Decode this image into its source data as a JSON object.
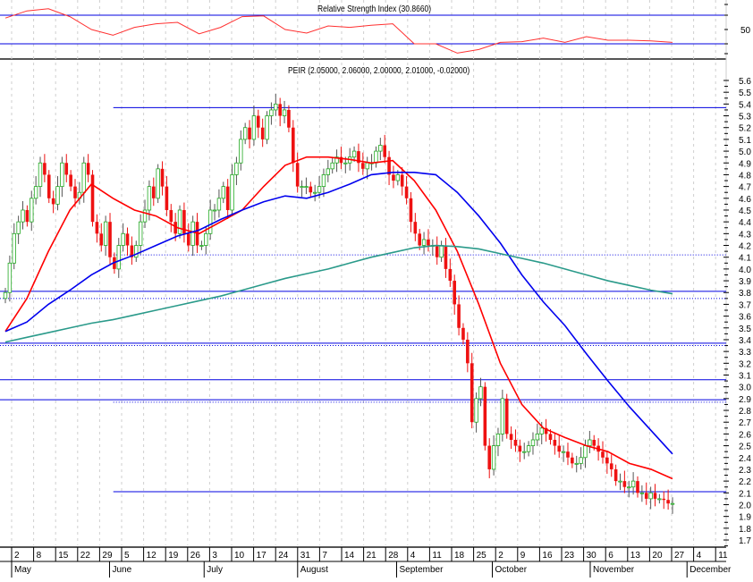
{
  "rsi_panel": {
    "title": "Relative Strength Index (30.8660)",
    "level_label": "50",
    "upper_level": 70,
    "lower_level": 30,
    "line_color": "#ff3030",
    "level_color": "#0000e0"
  },
  "price_panel": {
    "title": "PEIR (2.05000, 2.06000, 2.00000, 2.01000, -0.02000)",
    "up_color": "#22aa22",
    "down_color": "#ee1111"
  },
  "chart_data": {
    "type": "candlestick",
    "title": "PEIR (2.05000, 2.06000, 2.00000, 2.01000, -0.02000)",
    "ylim": [
      1.7,
      5.6
    ],
    "y_ticks": [
      "5.6",
      "5.5",
      "5.4",
      "5.3",
      "5.2",
      "5.1",
      "5.0",
      "4.9",
      "4.8",
      "4.7",
      "4.6",
      "4.5",
      "4.4",
      "4.3",
      "4.2",
      "4.1",
      "4.0",
      "3.9",
      "3.8",
      "3.7",
      "3.6",
      "3.5",
      "3.4",
      "3.3",
      "3.2",
      "3.1",
      "3.0",
      "2.9",
      "2.8",
      "2.7",
      "2.6",
      "2.5",
      "2.4",
      "2.3",
      "2.2",
      "2.1",
      "2.0",
      "1.9",
      "1.8",
      "1.7"
    ],
    "x_week_labels": [
      "2",
      "8",
      "15",
      "22",
      "29",
      "5",
      "12",
      "19",
      "26",
      "3",
      "10",
      "17",
      "24",
      "31",
      "7",
      "14",
      "21",
      "28",
      "4",
      "11",
      "18",
      "25",
      "2",
      "9",
      "16",
      "23",
      "30",
      "6",
      "13",
      "20",
      "27",
      "4",
      "11"
    ],
    "x_month_labels": [
      {
        "label": "May",
        "week": 0
      },
      {
        "label": "June",
        "week": 4.45
      },
      {
        "label": "July",
        "week": 8.75
      },
      {
        "label": "August",
        "week": 13
      },
      {
        "label": "September",
        "week": 17.5
      },
      {
        "label": "October",
        "week": 21.85
      },
      {
        "label": "November",
        "week": 26.3
      },
      {
        "label": "December",
        "week": 30.7
      }
    ],
    "closes": [
      3.8,
      4.05,
      4.3,
      4.4,
      4.5,
      4.4,
      4.6,
      4.7,
      4.9,
      4.8,
      4.6,
      4.55,
      4.7,
      4.9,
      4.8,
      4.7,
      4.6,
      4.65,
      4.9,
      4.8,
      4.4,
      4.3,
      4.2,
      4.4,
      4.1,
      4.0,
      4.2,
      4.3,
      4.2,
      4.1,
      4.2,
      4.4,
      4.5,
      4.7,
      4.6,
      4.85,
      4.7,
      4.5,
      4.4,
      4.3,
      4.5,
      4.3,
      4.2,
      4.4,
      4.2,
      4.2,
      4.3,
      4.5,
      4.5,
      4.6,
      4.7,
      4.5,
      4.8,
      4.9,
      5.1,
      5.2,
      5.1,
      5.3,
      5.2,
      5.1,
      5.3,
      5.35,
      5.4,
      5.3,
      5.35,
      5.2,
      4.9,
      4.7,
      4.7,
      4.7,
      4.65,
      4.65,
      4.7,
      4.8,
      4.85,
      4.9,
      4.95,
      4.9,
      4.9,
      4.95,
      5.0,
      4.9,
      4.85,
      4.9,
      4.9,
      5.0,
      5.05,
      4.95,
      4.8,
      4.75,
      4.8,
      4.7,
      4.6,
      4.4,
      4.3,
      4.2,
      4.25,
      4.2,
      4.2,
      4.1,
      4.2,
      4.0,
      3.9,
      3.7,
      3.5,
      3.4,
      3.2,
      2.7,
      2.9,
      3.0,
      2.5,
      2.3,
      2.5,
      2.6,
      2.9,
      2.6,
      2.55,
      2.5,
      2.45,
      2.45,
      2.5,
      2.55,
      2.6,
      2.65,
      2.6,
      2.55,
      2.5,
      2.45,
      2.45,
      2.4,
      2.35,
      2.35,
      2.4,
      2.5,
      2.55,
      2.5,
      2.45,
      2.4,
      2.35,
      2.3,
      2.2,
      2.2,
      2.15,
      2.15,
      2.2,
      2.1,
      2.1,
      2.05,
      2.1,
      2.05,
      2.05,
      2.04,
      2.01,
      2.01
    ],
    "series": [
      {
        "name": "MA short",
        "color": "#ff0000",
        "values": [
          3.47,
          3.75,
          4.15,
          4.5,
          4.72,
          4.6,
          4.5,
          4.45,
          4.35,
          4.3,
          4.4,
          4.5,
          4.7,
          4.88,
          4.95,
          4.95,
          4.93,
          4.9,
          4.92,
          4.75,
          4.5,
          4.15,
          3.7,
          3.2,
          2.85,
          2.65,
          2.57,
          2.5,
          2.45,
          2.35,
          2.3,
          2.22
        ]
      },
      {
        "name": "MA medium",
        "color": "#0000ee",
        "values": [
          3.47,
          3.55,
          3.7,
          3.82,
          3.95,
          4.05,
          4.12,
          4.2,
          4.28,
          4.33,
          4.42,
          4.5,
          4.57,
          4.62,
          4.6,
          4.65,
          4.72,
          4.8,
          4.82,
          4.82,
          4.8,
          4.65,
          4.45,
          4.22,
          3.95,
          3.72,
          3.52,
          3.28,
          3.05,
          2.83,
          2.63,
          2.43
        ]
      },
      {
        "name": "MA long",
        "color": "#2a9a8a",
        "values": [
          3.38,
          3.42,
          3.46,
          3.5,
          3.54,
          3.57,
          3.61,
          3.65,
          3.69,
          3.73,
          3.77,
          3.82,
          3.87,
          3.92,
          3.96,
          4.0,
          4.05,
          4.1,
          4.14,
          4.18,
          4.2,
          4.19,
          4.17,
          4.13,
          4.09,
          4.05,
          4.0,
          3.95,
          3.9,
          3.86,
          3.82,
          3.79
        ]
      }
    ],
    "rsi_values": [
      66,
      76,
      79,
      68,
      50,
      42,
      53,
      58,
      60,
      44,
      53,
      68,
      69,
      50,
      45,
      55,
      53,
      56,
      58,
      30,
      30,
      17,
      22,
      32,
      33,
      38,
      32,
      40,
      35,
      35,
      34,
      32
    ],
    "horizontal_levels": [
      {
        "value": 5.37,
        "style": "solid",
        "from_week": 4.5
      },
      {
        "value": 4.12,
        "style": "dotted",
        "from_week": 4.5
      },
      {
        "value": 3.81,
        "style": "solid",
        "from_week": -1
      },
      {
        "value": 3.75,
        "style": "dotted",
        "from_week": -1
      },
      {
        "value": 3.37,
        "style": "solid",
        "from_week": -1
      },
      {
        "value": 3.35,
        "style": "dotted",
        "from_week": -1
      },
      {
        "value": 3.06,
        "style": "solid",
        "from_week": -1
      },
      {
        "value": 2.89,
        "style": "solid",
        "from_week": -1
      },
      {
        "value": 2.87,
        "style": "dotted",
        "from_week": 4.5
      },
      {
        "value": 2.11,
        "style": "solid",
        "from_week": 4.5
      }
    ]
  }
}
